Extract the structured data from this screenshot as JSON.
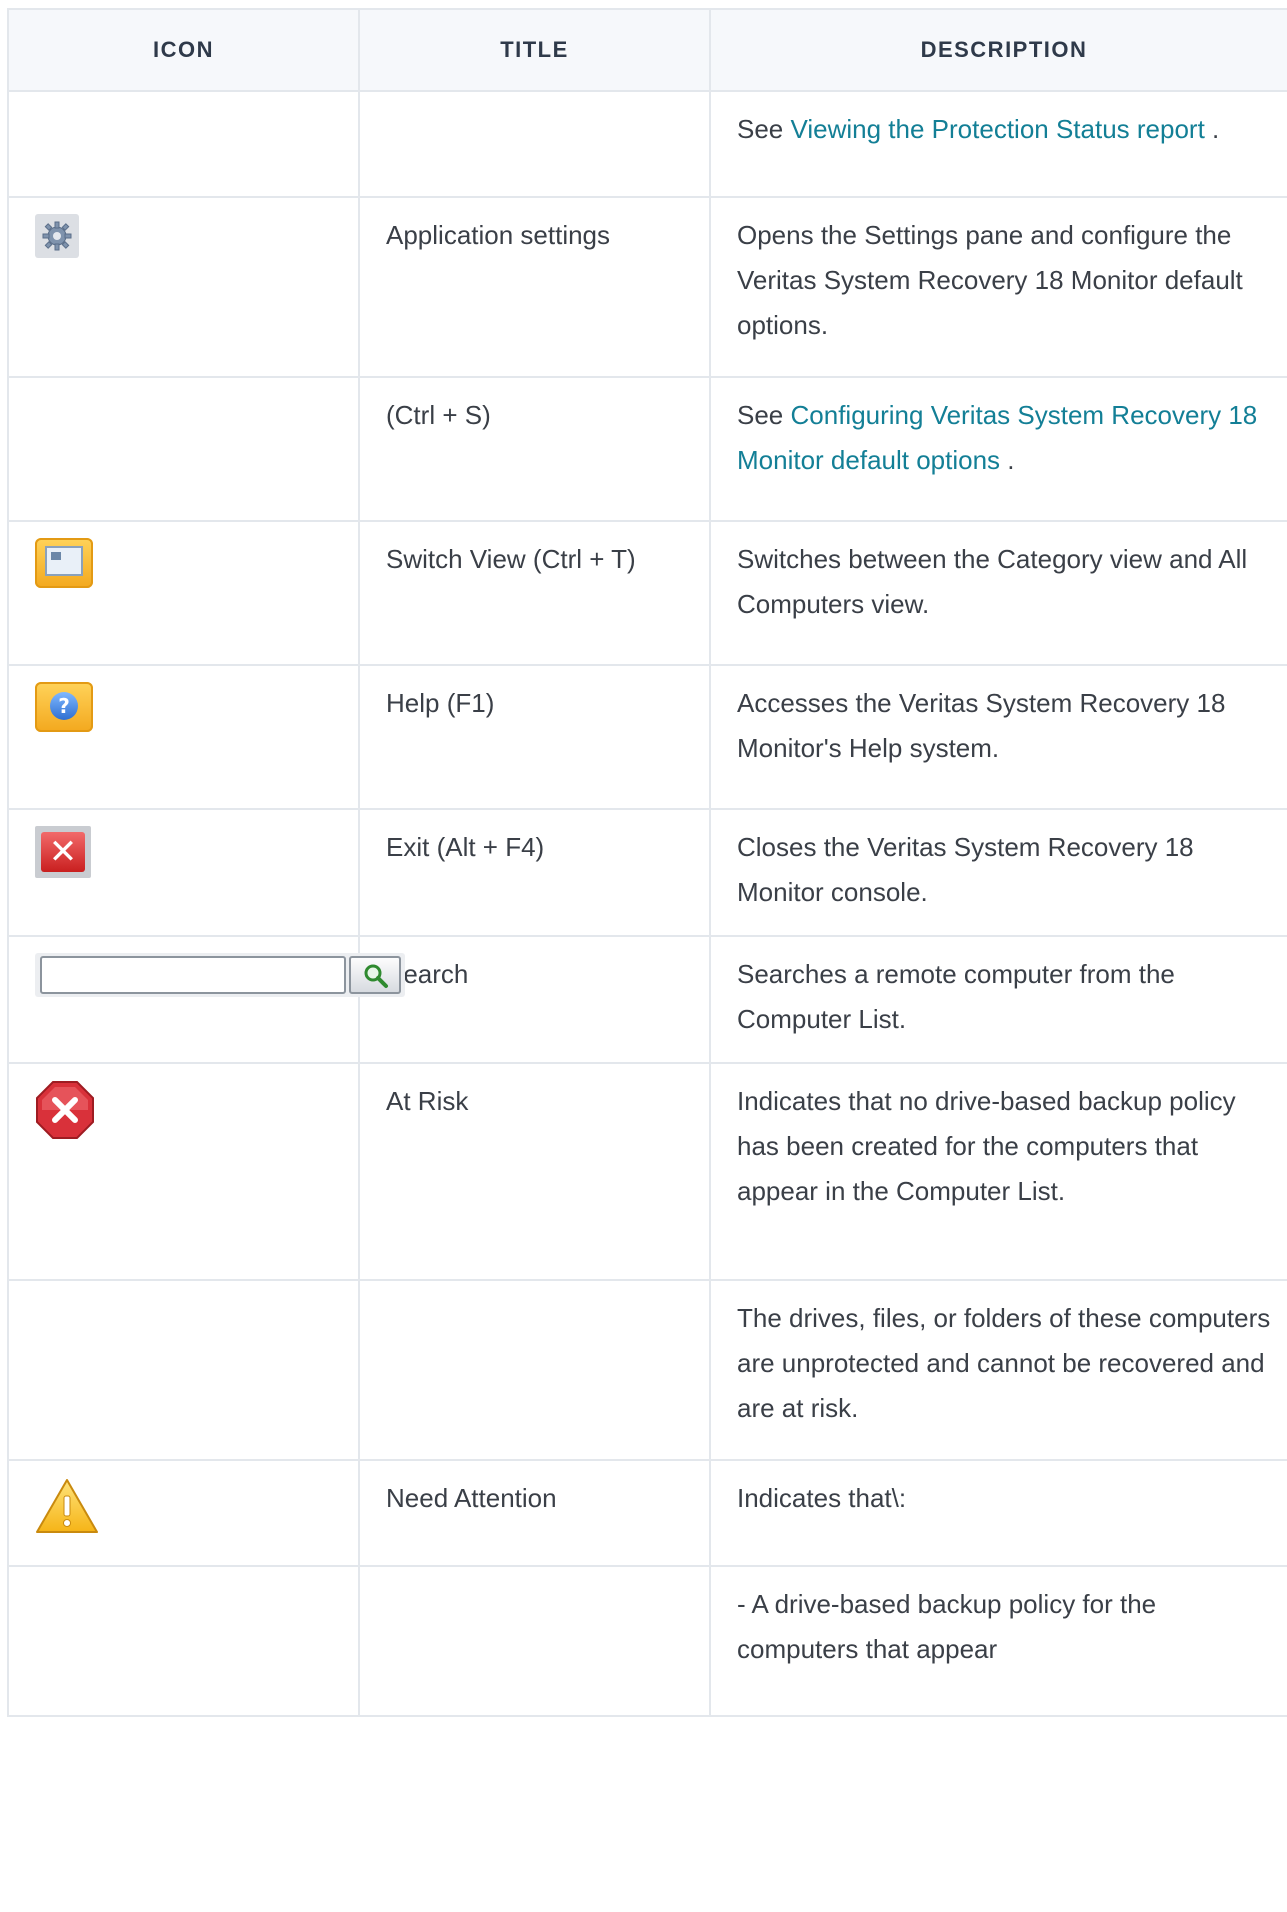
{
  "headers": {
    "icon": "ICON",
    "title": "TITLE",
    "description": "DESCRIPTION"
  },
  "rows": [
    {
      "title": "",
      "desc_prefix": "See ",
      "desc_link": "Viewing the Protection Status report",
      "desc_suffix": " ."
    },
    {
      "icon": "gear-icon",
      "title": "Application settings",
      "desc": "Opens the Settings pane and configure the Veritas System Recovery 18 Monitor default options."
    },
    {
      "title": "(Ctrl + S)",
      "desc_prefix": "See ",
      "desc_link": "Configuring Veritas System Recovery 18 Monitor default options",
      "desc_suffix": " ."
    },
    {
      "icon": "switch-view-icon",
      "title": "Switch View (Ctrl + T)",
      "desc": "Switches between the Category view and All Computers view."
    },
    {
      "icon": "help-icon",
      "title": "Help (F1)",
      "desc": "Accesses the Veritas System Recovery 18 Monitor's Help system."
    },
    {
      "icon": "exit-icon",
      "title": "Exit (Alt + F4)",
      "desc": "Closes the Veritas System Recovery 18 Monitor console."
    },
    {
      "icon": "search-box-icon",
      "title": "Search",
      "desc": "Searches a remote computer from the Computer List."
    },
    {
      "icon": "at-risk-icon",
      "title": "At Risk",
      "desc": "Indicates that no drive-based backup policy has been created for the computers that appear in the Computer List."
    },
    {
      "title": "",
      "desc": "The drives, files, or folders of these computers are unprotected and cannot be recovered and are at risk."
    },
    {
      "icon": "warning-icon",
      "title": "Need Attention",
      "desc": "Indicates that\\:"
    },
    {
      "title": "",
      "desc": "- A drive-based backup policy for the computers that appear"
    }
  ],
  "colors": {
    "link": "#137f96",
    "border": "#e3e7ec",
    "header_bg": "#f6f8fb"
  }
}
